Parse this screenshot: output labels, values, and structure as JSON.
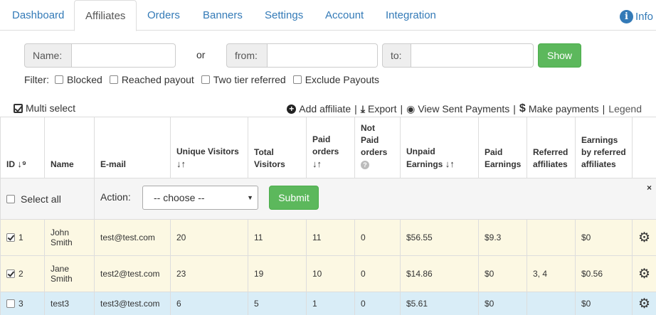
{
  "tabs": [
    {
      "label": "Dashboard",
      "active": false
    },
    {
      "label": "Affiliates",
      "active": true
    },
    {
      "label": "Orders",
      "active": false
    },
    {
      "label": "Banners",
      "active": false
    },
    {
      "label": "Settings",
      "active": false
    },
    {
      "label": "Account",
      "active": false
    },
    {
      "label": "Integration",
      "active": false
    }
  ],
  "info_label": "Info",
  "search": {
    "name_label": "Name:",
    "or_label": "or",
    "from_label": "from:",
    "to_label": "to:",
    "show_label": "Show"
  },
  "filter": {
    "label": "Filter:",
    "options": [
      "Blocked",
      "Reached payout",
      "Two tier referred",
      "Exclude Payouts"
    ]
  },
  "toolbar": {
    "multi_select": "Multi select",
    "add_affiliate": "Add affiliate",
    "export": "Export",
    "view_sent_payments": "View Sent Payments",
    "make_payments": "Make payments",
    "legend": "Legend"
  },
  "table": {
    "headers": {
      "id": "ID",
      "name": "Name",
      "email": "E-mail",
      "unique_visitors": "Unique Visitors",
      "total_visitors": "Total Visitors",
      "paid_orders": "Paid orders",
      "not_paid_orders": "Not Paid orders",
      "unpaid_earnings": "Unpaid Earnings",
      "paid_earnings": "Paid Earnings",
      "referred_affiliates": "Referred affiliates",
      "earnings_by_referred": "Earnings by referred affiliates"
    },
    "bulk": {
      "select_all": "Select all",
      "action_label": "Action:",
      "action_value": "-- choose --",
      "submit": "Submit",
      "close": "×"
    },
    "rows": [
      {
        "checked": true,
        "id": "1",
        "name": "John Smith",
        "email": "test@test.com",
        "unique_visitors": "20",
        "total_visitors": "11",
        "paid_orders": "11",
        "not_paid_orders": "0",
        "unpaid_earnings": "$56.55",
        "paid_earnings": "$9.3",
        "referred_affiliates": "",
        "earnings_by_referred": "$0",
        "highlight": "yellow"
      },
      {
        "checked": true,
        "id": "2",
        "name": "Jane Smith",
        "email": "test2@test.com",
        "unique_visitors": "23",
        "total_visitors": "19",
        "paid_orders": "10",
        "not_paid_orders": "0",
        "unpaid_earnings": "$14.86",
        "paid_earnings": "$0",
        "referred_affiliates": "3, 4",
        "earnings_by_referred": "$0.56",
        "highlight": "yellow"
      },
      {
        "checked": false,
        "id": "3",
        "name": "test3",
        "email": "test3@test.com",
        "unique_visitors": "6",
        "total_visitors": "5",
        "paid_orders": "1",
        "not_paid_orders": "0",
        "unpaid_earnings": "$5.61",
        "paid_earnings": "$0",
        "referred_affiliates": "",
        "earnings_by_referred": "$0",
        "highlight": "blue"
      }
    ]
  },
  "colors": {
    "link": "#337ab7",
    "success": "#5cb85c",
    "row_selected": "#fcf8e3",
    "row_hover": "#d9edf7"
  }
}
